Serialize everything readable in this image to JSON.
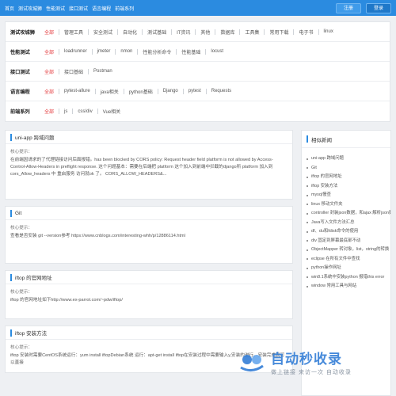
{
  "topnav": {
    "links": [
      "首页",
      "测试攻城狮",
      "性能测试",
      "接口测试",
      "语言编程",
      "前端系列"
    ],
    "login": "注册",
    "register": "登录"
  },
  "filters": [
    {
      "label": "测试攻城狮",
      "items": [
        "全部",
        "管理工具",
        "安全测试",
        "自动化",
        "测试基础",
        "IT资讯",
        "其他",
        "数据库",
        "工具集",
        "常用下载",
        "电子书",
        "linux"
      ]
    },
    {
      "label": "性能测试",
      "items": [
        "全部",
        "loadrunner",
        "jmeter",
        "nmon",
        "性能分析命令",
        "性能基础",
        "locust"
      ]
    },
    {
      "label": "接口测试",
      "items": [
        "全部",
        "接口基础",
        "Postman"
      ]
    },
    {
      "label": "语言编程",
      "items": [
        "全部",
        "pytest-allure",
        "java相关",
        "python基础",
        "Django",
        "pytest",
        "Requests"
      ]
    },
    {
      "label": "前端系列",
      "items": [
        "全部",
        "js",
        "css/div",
        "Vue相关"
      ]
    }
  ],
  "posts": [
    {
      "title": "uni-app 跨域问题",
      "hint": "核心提示：",
      "body": "在前端因请求的了代理链接访问后面报错。has been blocked by CORS policy: Request header field platform is not allowed by Access-Control-Allow-Headers in preflight response. 这个问题基本：需要在后端把 platform 这个加入到前端中拦截的django所 platform 加入到 cors_Allow_headers 中 重启服务 访问就ok 了。 CORS_ALLOW_HEADERS&..."
    },
    {
      "title": "Git",
      "hint": "核心提示：",
      "body": "查看是否安装 git --version参考 https://www.cnblogs.com/interesting-whh/p/12886114.html"
    },
    {
      "title": "iftop 的官网地址",
      "hint": "核心提示：",
      "body": "iftop 的官网地址如下http://www.ex-parrot.com/~pdw/iftop/"
    },
    {
      "title": "iftop 安装方法",
      "hint": "核心提示：",
      "body": "iftop 安装时需要CentOS系统运行：yum install iftopDebian系统 运行：apt-get install iftop在安装过程中需要输入y,安装的进行。安装完成就可以直接"
    }
  ],
  "sidebar": {
    "title": "相似新闻",
    "items": [
      "uni-app 跨域问题",
      "Git",
      "iftop 的官网地址",
      "iftop 安装方法",
      "mysql慢查",
      "linux 移动文件夹",
      "controller 封装json数据，和ajax 解析json数",
      "Java写入文件方法汇总",
      "df、du和fdisk命令的使用",
      "div 固定到屏幕最底部不动",
      "ObjectMapper 转对象，list，string的转换",
      "eclipse 在所有文件中查找",
      "python操作网址",
      "win8.1系统中安装python 报错this error",
      "window 常用工具与网站"
    ]
  },
  "watermark": {
    "title": "自动秒收录",
    "subtitle": "做上链接 来访一次 自动收录"
  }
}
